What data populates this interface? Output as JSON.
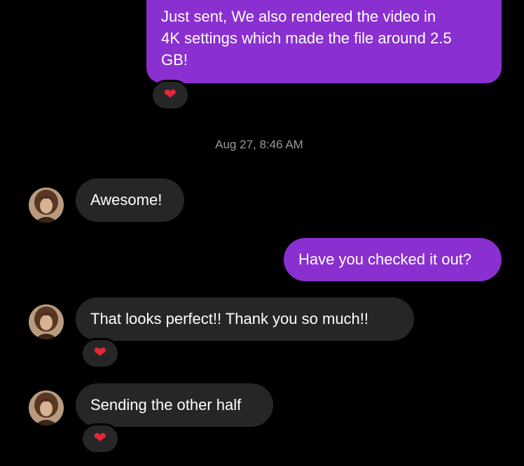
{
  "conversation": {
    "messages": [
      {
        "direction": "sent",
        "lines": [
          "Just sent, We also rendered the video in",
          "4K settings which made the file around 2.5",
          "GB!"
        ],
        "reaction": "heart-icon"
      },
      {
        "direction": "received",
        "text": "Awesome!"
      },
      {
        "direction": "sent",
        "text": "Have you checked it out?"
      },
      {
        "direction": "received",
        "text": "That looks perfect!! Thank you so much!!",
        "reaction": "heart-icon"
      },
      {
        "direction": "received",
        "text": "Sending the other half",
        "reaction": "heart-icon"
      }
    ],
    "timestamp": "Aug 27, 8:46 AM",
    "reaction_glyph": "❤"
  },
  "colors": {
    "background": "#000000",
    "sent_bubble": "#8a2fd0",
    "received_bubble": "#262626",
    "timestamp_text": "#9a9a9a",
    "heart": "#e8263a"
  }
}
